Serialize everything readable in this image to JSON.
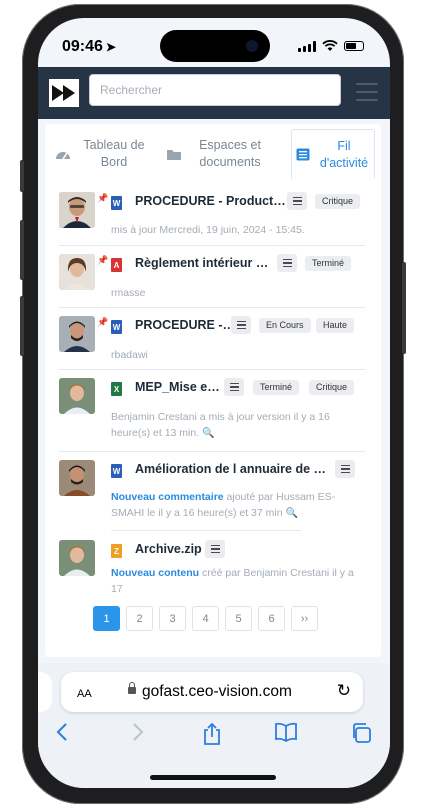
{
  "status": {
    "time": "09:46"
  },
  "appbar": {
    "search_placeholder": "Rechercher"
  },
  "tabs": [
    {
      "label": "Tableau de Bord",
      "icon": "dashboard-icon"
    },
    {
      "label": "Espaces et documents",
      "icon": "folder-icon"
    },
    {
      "label": "Fil d'activité",
      "icon": "list-icon",
      "active": true
    }
  ],
  "feed": [
    {
      "title": "PROCEDURE - Product…",
      "file": "word",
      "pinned": true,
      "badges": [
        "Critique"
      ],
      "meta": "mis à jour Mercredi, 19 juin, 2024 - 15:45."
    },
    {
      "title": "Règlement intérieur …",
      "file": "pdf",
      "pinned": true,
      "badges": [
        "Terminé"
      ],
      "meta": "rmasse"
    },
    {
      "title": "PROCEDURE -…",
      "file": "word",
      "pinned": true,
      "badges": [
        "En Cours",
        "Haute"
      ],
      "meta": "rbadawi"
    },
    {
      "title": "MEP_Mise e…",
      "file": "excel",
      "pinned": false,
      "badges": [
        "Terminé",
        "Critique"
      ],
      "meta": "Benjamin Crestani a mis à jour version il y a 16 heure(s) et 13 min."
    },
    {
      "title": "Amélioration de l annuaire de …",
      "file": "word",
      "pinned": false,
      "badges": [],
      "meta_highlight": "Nouveau commentaire",
      "meta": "ajouté par Hussam ES-SMAHI le il y a 16 heure(s) et 37 min"
    },
    {
      "title": "Archive.zip",
      "file": "zip",
      "pinned": false,
      "badges": [],
      "meta_highlight": "Nouveau contenu",
      "meta": "créé par Benjamin Crestani il y a 17"
    }
  ],
  "pager": [
    "1",
    "2",
    "3",
    "4",
    "5",
    "6",
    "››"
  ],
  "pager_active": "1",
  "safari": {
    "aa": "AA",
    "url": "gofast.ceo-vision.com"
  },
  "colors": {
    "appbar": "#263445",
    "accent": "#2b8be0",
    "page_active": "#2b95ea"
  }
}
